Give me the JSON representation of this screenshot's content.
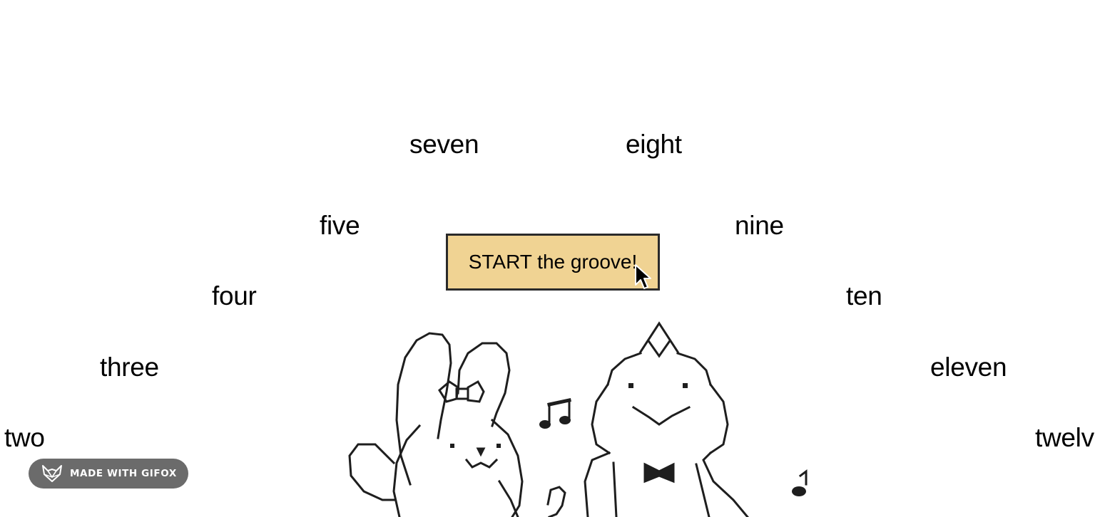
{
  "button": {
    "label": "START the groove!",
    "bg_color": "#f0d393"
  },
  "clock_words": {
    "two": "two",
    "three": "three",
    "four": "four",
    "five": "five",
    "seven": "seven",
    "eight": "eight",
    "nine": "nine",
    "ten": "ten",
    "eleven": "eleven",
    "twelve": "twelv"
  },
  "badge": {
    "label": "MADE WITH GIFOX",
    "icon": "fox-logo-icon",
    "bg_color": "#6b6b6b"
  },
  "icons": {
    "cursor": "arrow-cursor-icon",
    "illustration": "bunny-and-frog-illustration"
  }
}
